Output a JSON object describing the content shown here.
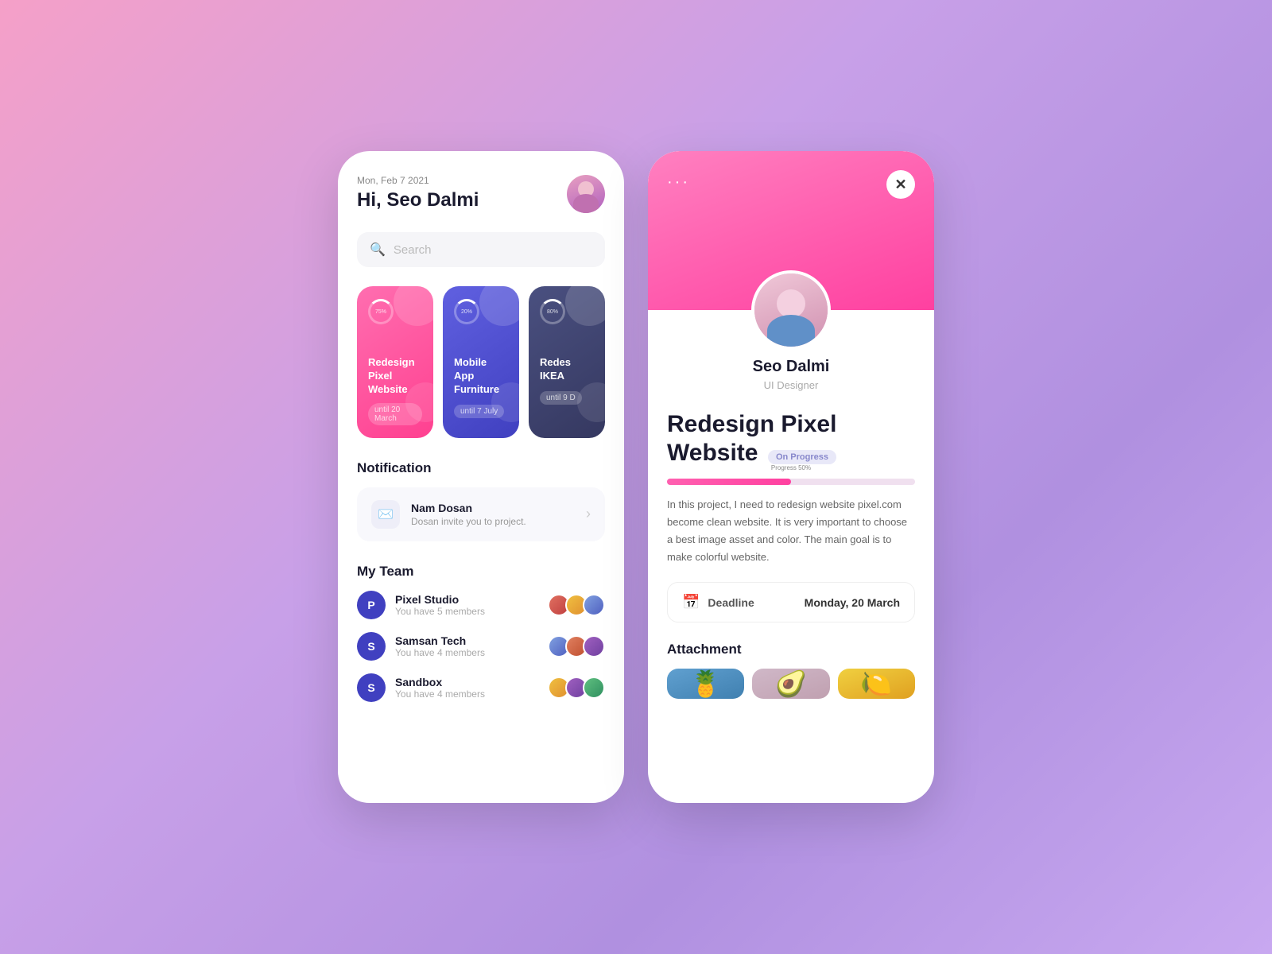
{
  "background": {
    "gradient_start": "#f5a0c8",
    "gradient_end": "#c8a0e8"
  },
  "left_phone": {
    "date": "Mon, Feb 7 2021",
    "greeting": "Hi, Seo Dalmi",
    "search_placeholder": "Search",
    "projects_section": {
      "cards": [
        {
          "title": "Redesign Pixel Website",
          "deadline": "until 20 March",
          "progress": "75%",
          "color": "pink"
        },
        {
          "title": "Mobile App Furniture",
          "deadline": "until 7 July",
          "progress": "20%",
          "color": "purple"
        },
        {
          "title": "Redes IKEA",
          "deadline": "until 9 D",
          "progress": "80%",
          "color": "dark"
        }
      ]
    },
    "notification_section": {
      "title": "Notification",
      "item": {
        "name": "Nam Dosan",
        "description": "Dosan invite you to project."
      }
    },
    "team_section": {
      "title": "My Team",
      "teams": [
        {
          "icon_letter": "P",
          "name": "Pixel Studio",
          "count": "You have 5 members",
          "avatars": [
            "ta1",
            "ta2",
            "ta3"
          ]
        },
        {
          "icon_letter": "S",
          "name": "Samsan Tech",
          "count": "You have 4 members",
          "avatars": [
            "ta3",
            "ta4",
            "ta5"
          ]
        },
        {
          "icon_letter": "S",
          "name": "Sandbox",
          "count": "You have 4 members",
          "avatars": [
            "ta2",
            "ta5",
            "ta6"
          ]
        }
      ]
    }
  },
  "right_phone": {
    "dots": "···",
    "close_label": "✕",
    "profile": {
      "name": "Seo Dalmi",
      "role": "UI Designer"
    },
    "project": {
      "title": "Redesign Pixel Website",
      "badge": "On Progress",
      "progress_percent": 50,
      "progress_label": "Progress 50%",
      "description": "In this project, I need to redesign website pixel.com become clean website. It is very important to choose a best image asset and color. The main goal is to make colorful website.",
      "deadline_label": "Deadline",
      "deadline_date": "Monday, 20 March"
    },
    "attachment": {
      "title": "Attachment",
      "images": [
        {
          "emoji": "🍍",
          "bg": "pineapple"
        },
        {
          "emoji": "🥑",
          "bg": "avocado"
        },
        {
          "emoji": "🍋",
          "bg": "yellow"
        }
      ]
    }
  }
}
